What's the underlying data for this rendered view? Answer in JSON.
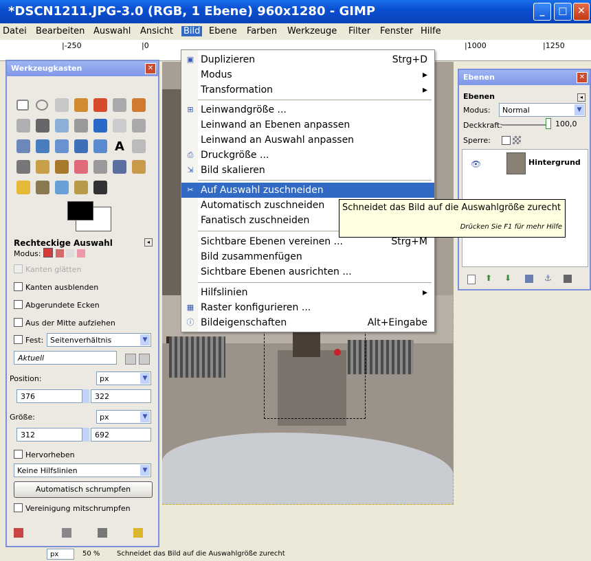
{
  "window": {
    "title": "*DSCN1211.JPG-3.0 (RGB, 1 Ebene) 960x1280 - GIMP"
  },
  "menubar": [
    "Datei",
    "Bearbeiten",
    "Auswahl",
    "Ansicht",
    "Bild",
    "Ebene",
    "Farben",
    "Werkzeuge",
    "Filter",
    "Fenster",
    "Hilfe"
  ],
  "ruler": {
    "ticks": [
      "|-250",
      "|0",
      "|1000",
      "|1250"
    ]
  },
  "bild_menu": {
    "items": [
      {
        "label": "Duplizieren",
        "shortcut": "Strg+D"
      },
      {
        "label": "Modus",
        "shortcut": "▸"
      },
      {
        "label": "Transformation",
        "shortcut": "▸"
      },
      {
        "label": "Leinwandgröße ...",
        "shortcut": ""
      },
      {
        "label": "Leinwand an Ebenen anpassen",
        "shortcut": ""
      },
      {
        "label": "Leinwand an Auswahl anpassen",
        "shortcut": ""
      },
      {
        "label": "Druckgröße ...",
        "shortcut": ""
      },
      {
        "label": "Bild skalieren",
        "shortcut": ""
      },
      {
        "label": "Auf Auswahl zuschneiden",
        "shortcut": ""
      },
      {
        "label": "Automatisch zuschneiden",
        "shortcut": ""
      },
      {
        "label": "Fanatisch zuschneiden",
        "shortcut": ""
      },
      {
        "label": "Sichtbare Ebenen vereinen ...",
        "shortcut": "Strg+M"
      },
      {
        "label": "Bild zusammenfügen",
        "shortcut": ""
      },
      {
        "label": "Sichtbare Ebenen ausrichten ...",
        "shortcut": ""
      },
      {
        "label": "Hilfslinien",
        "shortcut": "▸"
      },
      {
        "label": "Raster konfigurieren ...",
        "shortcut": ""
      },
      {
        "label": "Bildeigenschaften",
        "shortcut": "Alt+Eingabe"
      }
    ]
  },
  "tooltip": {
    "text": "Schneidet das Bild auf die Auswahlgröße zurecht",
    "hint": "Drücken Sie F1 für mehr Hilfe"
  },
  "toolbox": {
    "title": "Werkzeugkasten",
    "tool_name": "Rechteckige Auswahl",
    "modus_label": "Modus:",
    "options": {
      "kanten_glaetten": "Kanten glätten",
      "kanten_ausblenden": "Kanten ausblenden",
      "abgerundete_ecken": "Abgerundete Ecken",
      "aus_der_mitte": "Aus der Mitte aufziehen",
      "fest": "Fest:",
      "fest_value": "Seitenverhältnis",
      "aktuell": "Aktuell",
      "position_label": "Position:",
      "position_unit": "px",
      "position_x": "376",
      "position_y": "322",
      "groesse_label": "Größe:",
      "groesse_unit": "px",
      "groesse_w": "312",
      "groesse_h": "692",
      "hervorheben": "Hervorheben",
      "hilfslinien": "Keine Hilfslinien",
      "auto_shrink": "Automatisch schrumpfen",
      "vereinigung": "Vereinigung mitschrumpfen"
    }
  },
  "layers": {
    "title": "Ebenen",
    "heading": "Ebenen",
    "modus_label": "Modus:",
    "modus_value": "Normal",
    "deckkraft_label": "Deckkraft:",
    "deckkraft_value": "100,0",
    "sperre_label": "Sperre:",
    "layer_name": "Hintergrund"
  },
  "status": {
    "unit": "px",
    "zoom": "50 %",
    "message": "Schneidet das Bild auf die Auswahlgröße zurecht"
  }
}
